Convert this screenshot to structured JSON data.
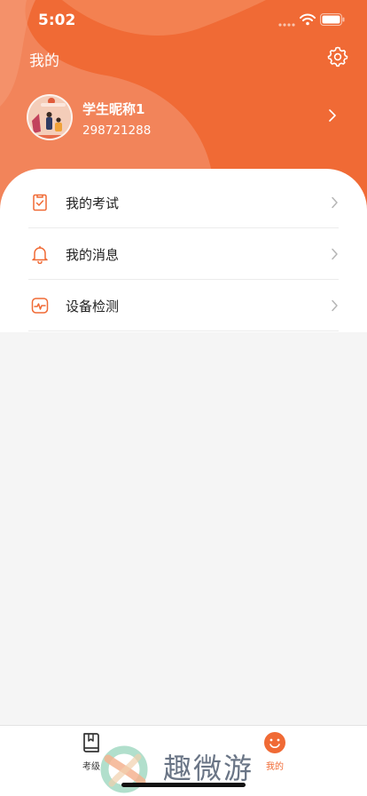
{
  "status_bar": {
    "time": "5:02"
  },
  "header": {
    "title": "我的"
  },
  "profile": {
    "nickname": "学生昵称1",
    "user_id": "298721288"
  },
  "menu": [
    {
      "label": "我的考试",
      "icon": "exam-checklist-icon"
    },
    {
      "label": "我的消息",
      "icon": "bell-icon"
    },
    {
      "label": "设备检测",
      "icon": "device-check-icon"
    }
  ],
  "tabbar": {
    "tabs": [
      {
        "label": "考级",
        "icon": "book-icon",
        "active": false
      },
      {
        "label": "我的",
        "icon": "smiley-icon",
        "active": true
      }
    ]
  },
  "watermark": {
    "text": "趣微游"
  },
  "colors": {
    "accent": "#f06a35",
    "background": "#f5f5f5",
    "card": "#ffffff"
  }
}
